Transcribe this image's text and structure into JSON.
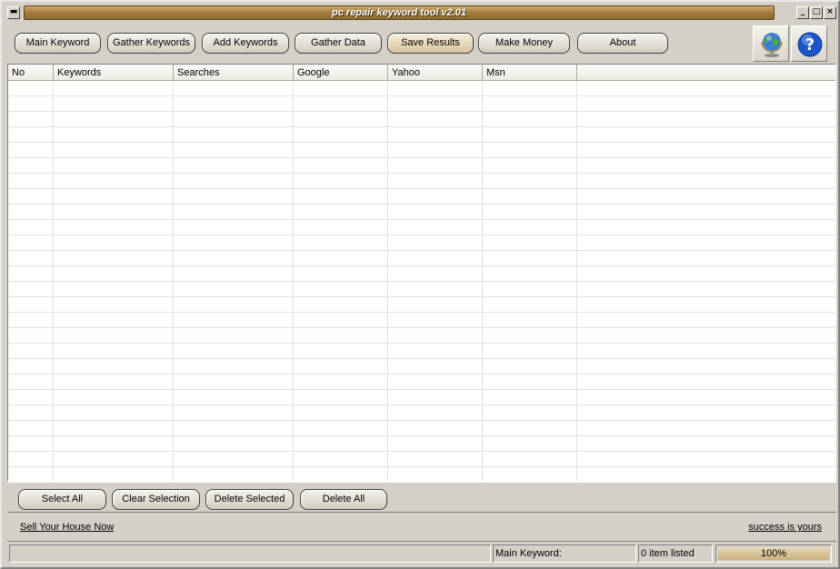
{
  "window": {
    "title": "pc repair keyword tool v2.01"
  },
  "titlebar_controls": {
    "system": "▬",
    "minimize": "_",
    "maximize": "□",
    "close": "×"
  },
  "toolbar": {
    "main_keyword": "Main Keyword",
    "gather_keywords": "Gather Keywords",
    "add_keywords": "Add Keywords",
    "gather_data": "Gather Data",
    "save_results": "Save Results",
    "make_money": "Make Money",
    "about": "About",
    "icons": [
      "globe-icon",
      "help-icon"
    ]
  },
  "table": {
    "columns": [
      "No",
      "Keywords",
      "Searches",
      "Google",
      "Yahoo",
      "Msn"
    ],
    "rows": []
  },
  "actions": {
    "select_all": "Select All",
    "clear_selection": "Clear Selection",
    "delete_selected": "Delete Selected",
    "delete_all": "Delete All"
  },
  "links": {
    "left": "Sell Your House Now",
    "right": "success is yours"
  },
  "status": {
    "message": "",
    "main_keyword_label": "Main Keyword:",
    "items_listed": "0 item listed",
    "progress_text": "100%",
    "progress_fraction": 1.0
  },
  "colors": {
    "title_bar": "#a67c3c",
    "window_bg": "#d4d0c8"
  }
}
